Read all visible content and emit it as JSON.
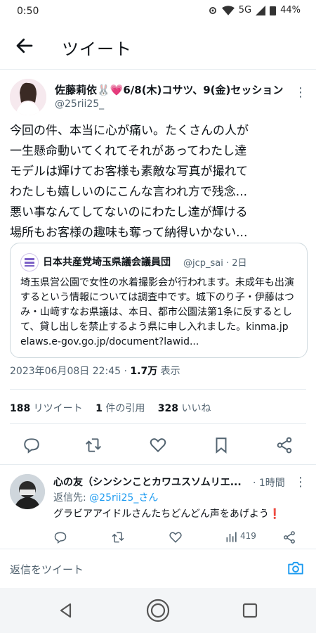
{
  "status_bar": {
    "time": "0:50",
    "network": "5G",
    "battery": "44%"
  },
  "header": {
    "title": "ツイート"
  },
  "tweet": {
    "author_name": "佐藤莉依🐰💗6/8(木)コサツ、9(金)セッション",
    "author_handle": "@25rii25_",
    "text": "今回の件、本当に心が痛い。たくさんの人が\n一生懸命動いてくれてそれがあってわたし達\nモデルは輝けてお客様も素敵な写真が撮れて\nわたしも嬉しいのにこんな言われ方で残念...\n悪い事なんてしてないのにわたし達が輝ける\n場所もお客様の趣味も奪って納得いかない...",
    "quote": {
      "author_name": "日本共産党埼玉県議会議員団",
      "author_handle": "@jcp_sai · 2日",
      "text": "埼玉県営公園で女性の水着撮影会が行われます。未成年も出演するという情報については調査中です。城下のり子・伊藤はつみ・山﨑すなお県議は、本日、都市公園法第1条に反するとして、貸し出しを禁止するよう県に申し入れました。kinma.jp　elaws.e-gov.go.jp/document?lawid..."
    },
    "timestamp": "2023年06月08日 22:45 · ",
    "views_count": "1.7万",
    "views_label": " 表示",
    "stats": {
      "retweets_count": "188",
      "retweets_label": " リツイート",
      "quotes_count": "1",
      "quotes_label": " 件の引用",
      "likes_count": "328",
      "likes_label": " いいね"
    }
  },
  "reply": {
    "author_name": "心の友（シンシンことカワユスソムリエ...",
    "time": "· 1時間",
    "reply_to_label": "返信先: ",
    "reply_to_handle": "@25rii25_さん",
    "text": "グラビアアイドルさんたちどんどん声をあげよう❗",
    "views": "419"
  },
  "composer": {
    "placeholder": "返信をツイート"
  },
  "colors": {
    "accent": "#1d9bf0",
    "secondary_text": "#536471",
    "alert_red": "#e0245e"
  }
}
